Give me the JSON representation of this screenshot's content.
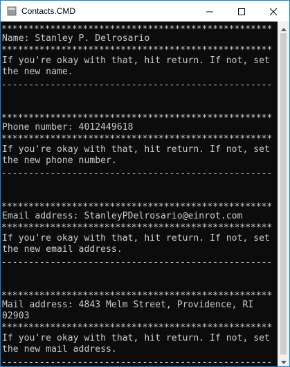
{
  "window": {
    "title": "Contacts.CMD",
    "controls": {
      "minimize_icon": "minimize-icon",
      "maximize_icon": "maximize-icon",
      "close_icon": "close-icon"
    }
  },
  "console": {
    "rule_star": "**************************************************",
    "rule_dash": "--------------------------------------------------",
    "sections": [
      {
        "value_line": "Name: Stanley P. Delrosario",
        "prompt_line1": "If you're okay with that, hit return. If not, set",
        "prompt_line2": "the new name."
      },
      {
        "value_line": "Phone number: 4012449618",
        "prompt_line1": "If you're okay with that, hit return. If not, set",
        "prompt_line2": "the new phone number."
      },
      {
        "value_line": "Email address: StanleyPDelrosario@einrot.com",
        "prompt_line1": "If you're okay with that, hit return. If not, set",
        "prompt_line2": "the new email address."
      },
      {
        "value_line": "Mail address: 4843 Melm Street, Providence, RI",
        "value_line2": "02903",
        "prompt_line1": "If you're okay with that, hit return. If not, set",
        "prompt_line2": "the new mail address."
      }
    ]
  },
  "colors": {
    "console_bg": "#0c0c0c",
    "console_text": "#cccccc",
    "window_border": "#1883d7"
  }
}
